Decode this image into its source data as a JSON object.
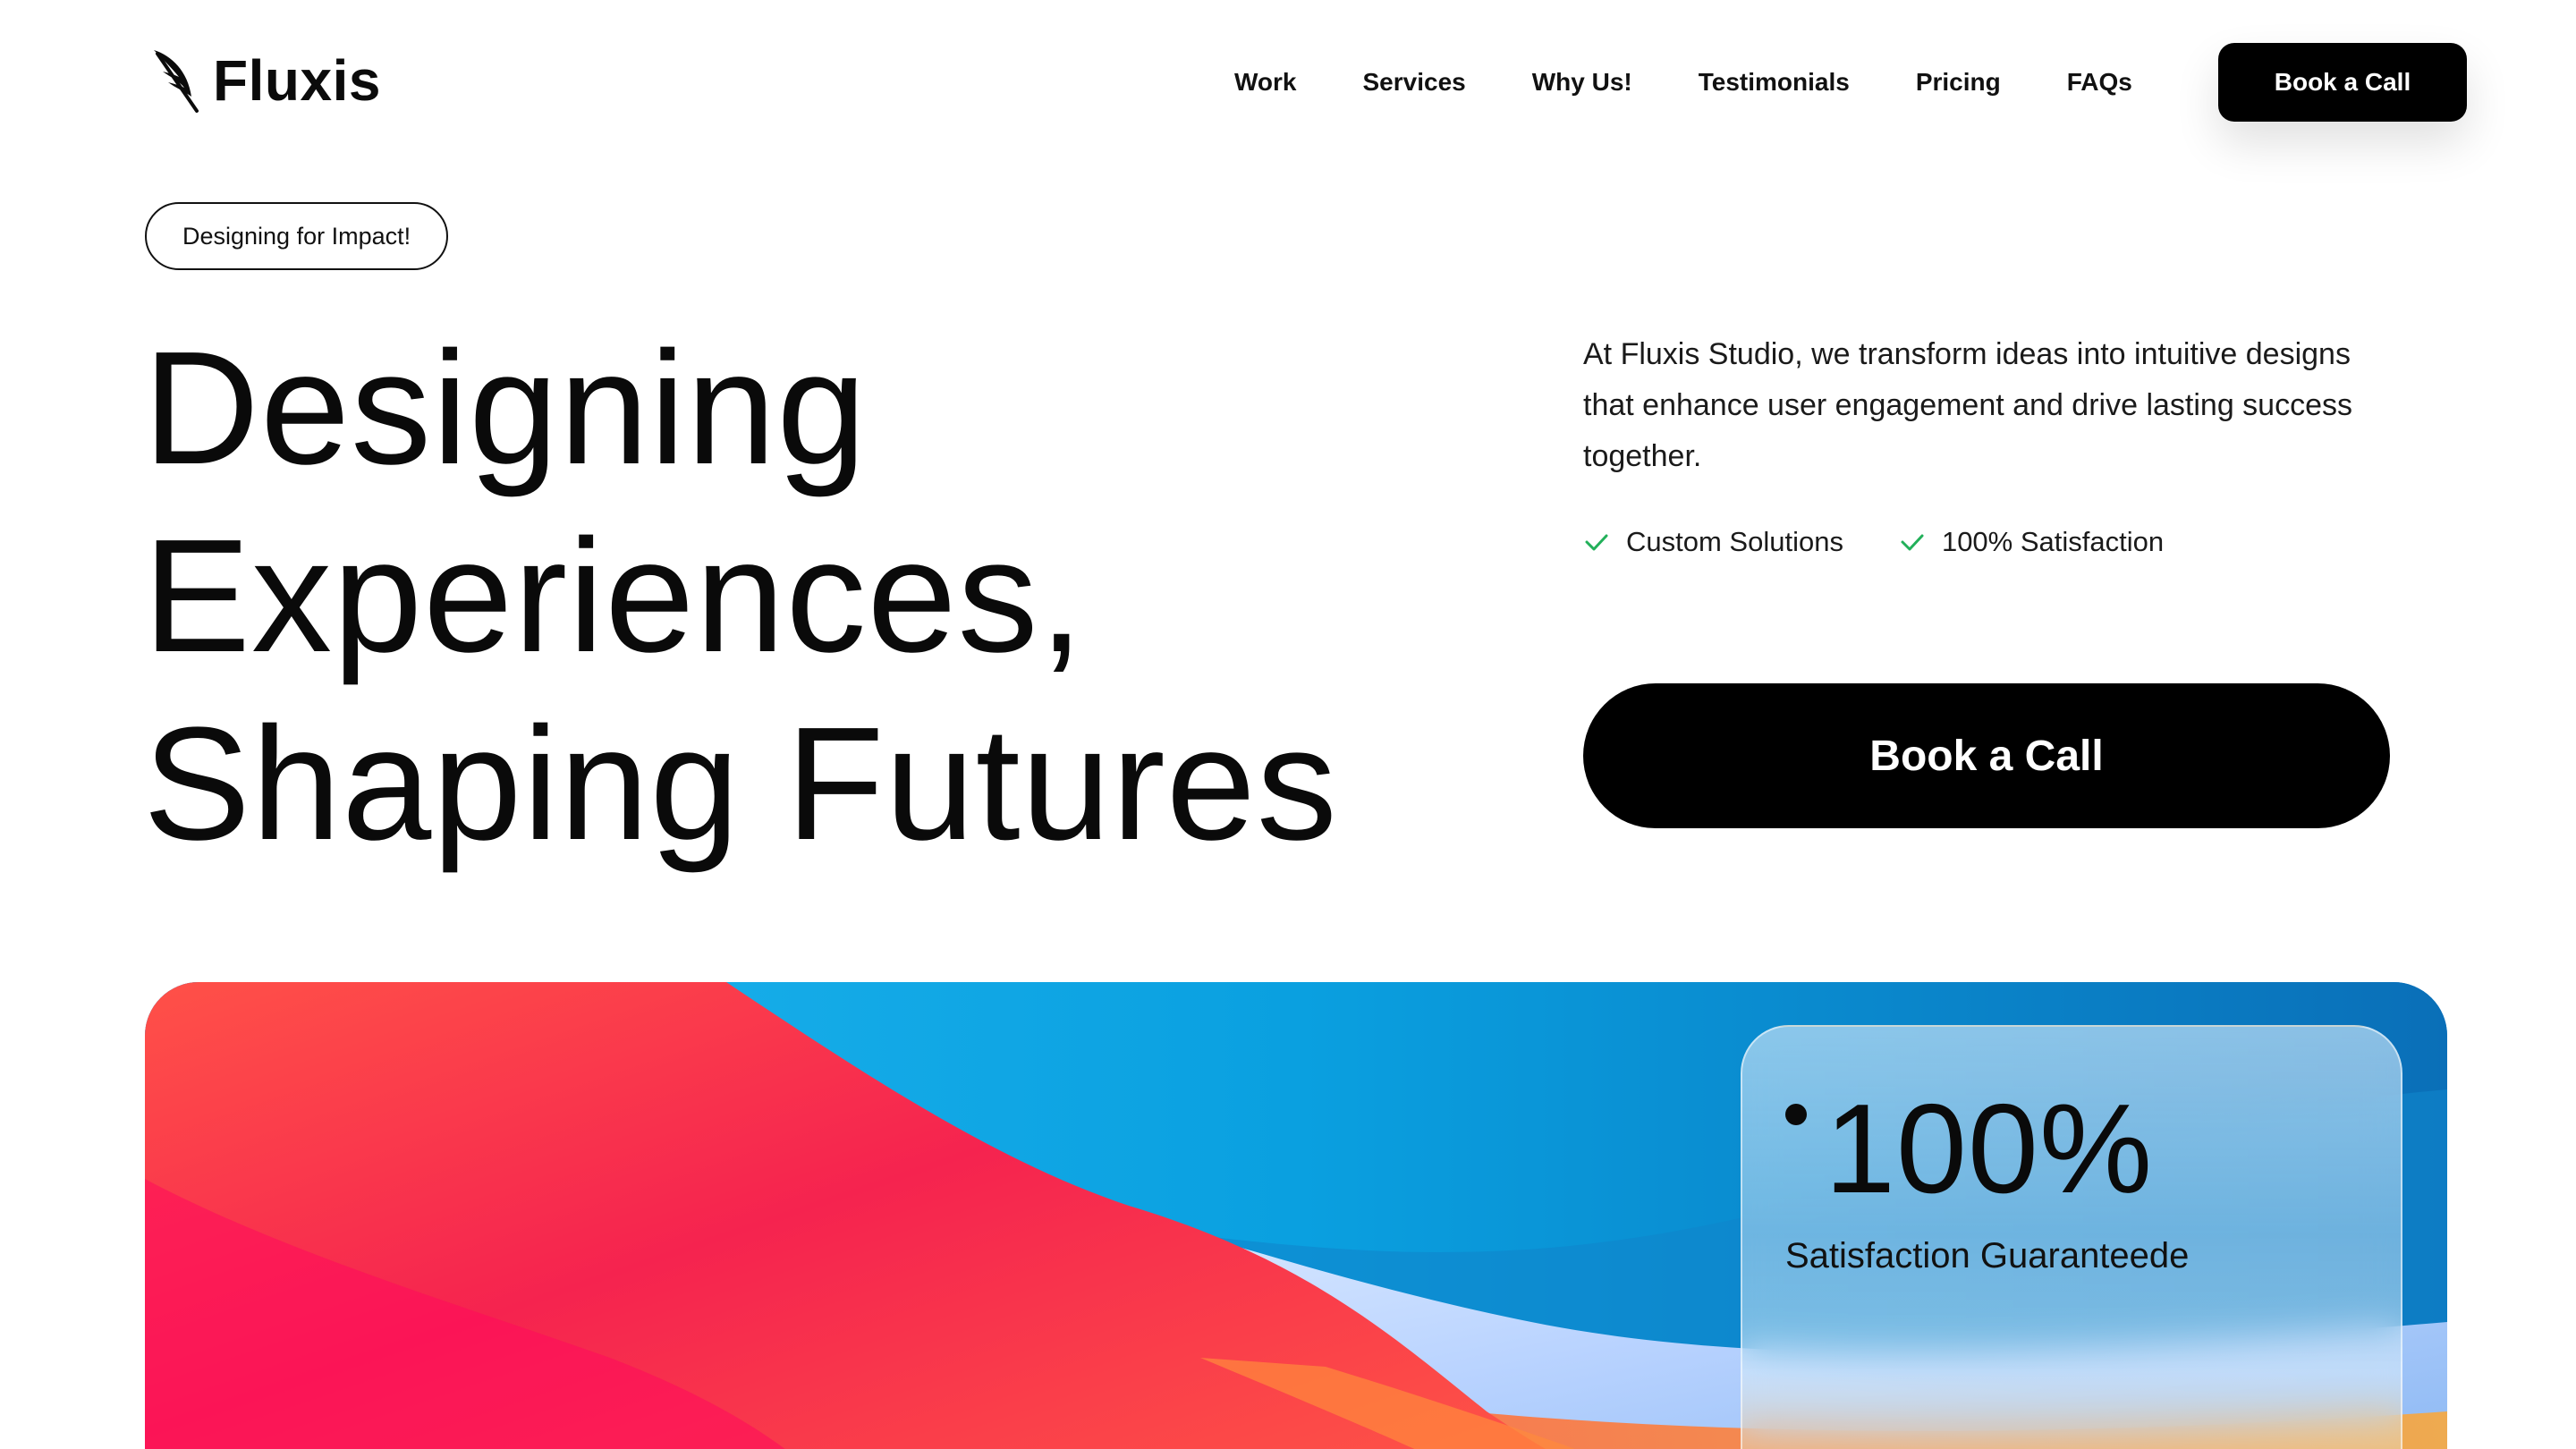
{
  "brand": {
    "name": "Fluxis",
    "icon": "feather-icon"
  },
  "nav": {
    "items": [
      {
        "label": "Work"
      },
      {
        "label": "Services"
      },
      {
        "label": "Why Us!"
      },
      {
        "label": "Testimonials"
      },
      {
        "label": "Pricing"
      },
      {
        "label": "FAQs"
      }
    ],
    "cta_label": "Book a Call"
  },
  "hero": {
    "badge": "Designing for Impact!",
    "title_lines": [
      "Designing",
      "Experiences,",
      "Shaping Futures"
    ],
    "description": "At Fluxis Studio, we transform ideas into intuitive designs that enhance user engagement and drive lasting success together.",
    "features": [
      {
        "label": "Custom Solutions",
        "icon": "check-icon"
      },
      {
        "label": "100% Satisfaction",
        "icon": "check-icon"
      }
    ],
    "cta_label": "Book a Call"
  },
  "stat_card": {
    "value": "100%",
    "label": "Satisfaction Guaranteede"
  },
  "colors": {
    "accent": "#000000",
    "check": "#22b05a",
    "wave_red": "#f0264e",
    "wave_blue": "#1aa9e6",
    "wave_orange": "#f6a53c"
  }
}
